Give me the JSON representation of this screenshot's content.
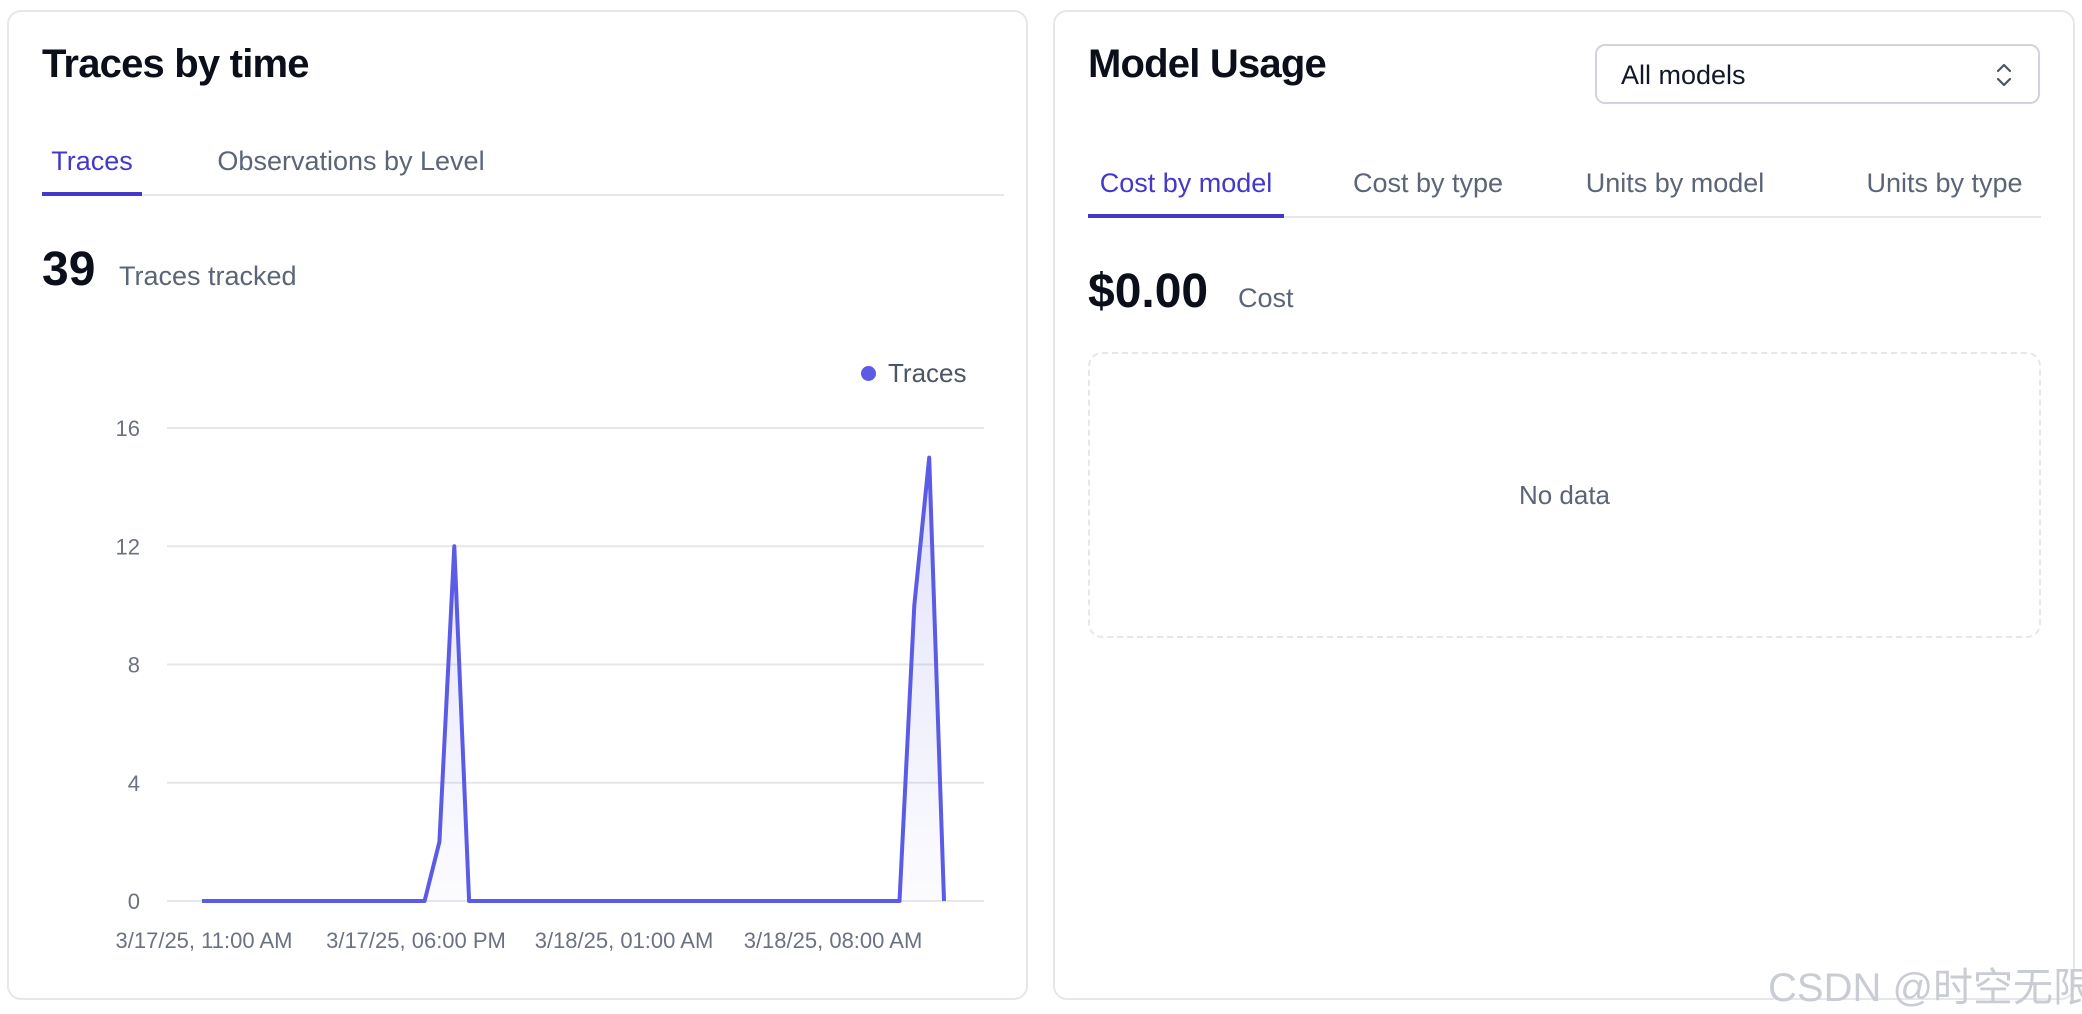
{
  "traces_card": {
    "title": "Traces by time",
    "tabs": [
      {
        "label": "Traces",
        "active": true
      },
      {
        "label": "Observations by Level",
        "active": false
      }
    ],
    "metric": {
      "value": "39",
      "label": "Traces tracked"
    },
    "legend_label": "Traces"
  },
  "model_card": {
    "title": "Model Usage",
    "select_value": "All models",
    "tabs": [
      {
        "label": "Cost by model",
        "active": true
      },
      {
        "label": "Cost by type",
        "active": false
      },
      {
        "label": "Units by model",
        "active": false
      },
      {
        "label": "Units by type",
        "active": false
      }
    ],
    "metric": {
      "value": "$0.00",
      "label": "Cost"
    },
    "empty_message": "No data"
  },
  "watermark": "CSDN @时空无限",
  "colors": {
    "accent": "#4338ca",
    "series": "#5b5be6"
  },
  "chart_data": {
    "type": "area",
    "series": [
      {
        "name": "Traces",
        "values": [
          0,
          0,
          0,
          0,
          0,
          0,
          0,
          0,
          0,
          0,
          0,
          0,
          0,
          0,
          0,
          0,
          2,
          12,
          0,
          0,
          0,
          0,
          0,
          0,
          0,
          0,
          0,
          0,
          0,
          0,
          0,
          0,
          0,
          0,
          0,
          0,
          0,
          0,
          0,
          0,
          0,
          0,
          0,
          0,
          0,
          0,
          0,
          0,
          10,
          15,
          0
        ]
      }
    ],
    "x_tick_labels": [
      "3/17/25, 11:00 AM",
      "3/17/25, 06:00 PM",
      "3/18/25, 01:00 AM",
      "3/18/25, 08:00 AM"
    ],
    "x_tick_index": [
      0,
      7,
      14,
      21
    ],
    "y_ticks": [
      0,
      4,
      8,
      12,
      16
    ],
    "ylim": [
      0,
      16
    ],
    "grid": true,
    "legend_position": "top-right"
  }
}
